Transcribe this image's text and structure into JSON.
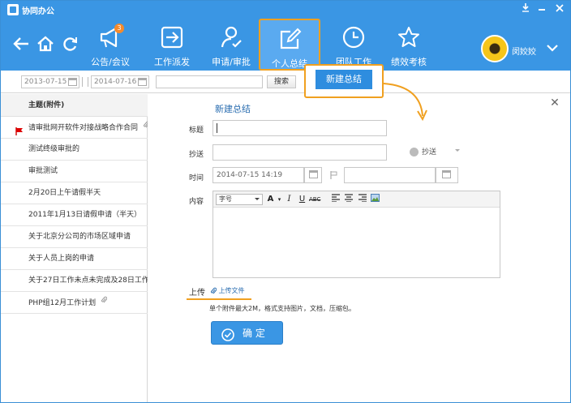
{
  "app": {
    "title": "协同办公"
  },
  "window_controls": [
    "pin-icon",
    "minimize-icon",
    "close-icon"
  ],
  "nav": {
    "items": [
      {
        "label": "公告/会议",
        "icon": "megaphone-icon",
        "badge": "3"
      },
      {
        "label": "工作派发",
        "icon": "arrow-out-icon"
      },
      {
        "label": "申请/审批",
        "icon": "person-check-icon"
      },
      {
        "label": "个人总结",
        "icon": "edit-icon",
        "active": true
      },
      {
        "label": "团队工作",
        "icon": "clock-icon"
      },
      {
        "label": "绩效考核",
        "icon": "star-icon"
      }
    ],
    "user_name": "闵姣姣"
  },
  "toolbar": {
    "start_date": "2013-07-15",
    "end_date": "2014-07-16",
    "search_placeholder": "",
    "search_label": "搜索"
  },
  "list": {
    "header": "主题(附件)",
    "items": [
      {
        "title": "请审批网开软件对接战略合作合同",
        "flagged": true,
        "attachment": true
      },
      {
        "title": "测试终级审批的"
      },
      {
        "title": "审批测试"
      },
      {
        "title": "2月20日上午请假半天"
      },
      {
        "title": "2011年1月13日请假申请（半天）"
      },
      {
        "title": "关于北京分公司的市场区域申请"
      },
      {
        "title": "关于人员上岗的申请"
      },
      {
        "title": "关于27日工作未点未完成及28日工作"
      },
      {
        "title": "PHP组12月工作计划",
        "attachment": true
      }
    ]
  },
  "form": {
    "title": "新建总结",
    "title_label": "标题",
    "cc_label": "抄送",
    "cc_button": "抄送",
    "time_label": "时间",
    "start_time": "2014-07-15 14:19",
    "end_time": "",
    "content_label": "内容",
    "font_size_label": "字号",
    "upload_label": "上传",
    "upload_link": "上传文件",
    "upload_hint": "单个附件最大2M，格式支持图片，文档，压缩包。",
    "confirm_label": "确 定"
  },
  "callout": {
    "label": "新建总结"
  },
  "colors": {
    "primary": "#3a96e4",
    "highlight": "#f0a020",
    "link": "#2a6db0"
  }
}
